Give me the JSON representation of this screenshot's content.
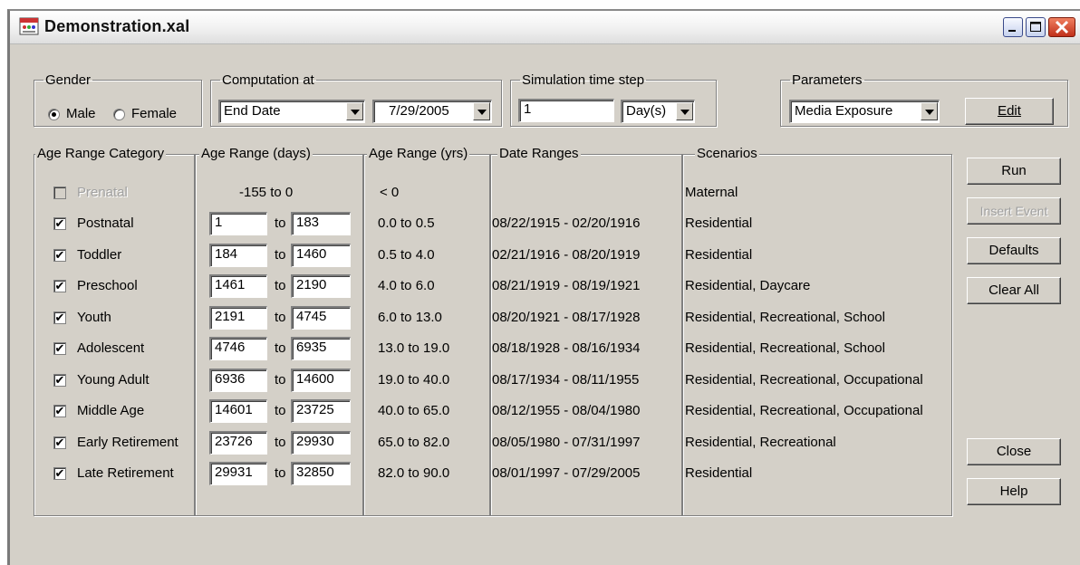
{
  "window": {
    "title": "Demonstration.xal"
  },
  "gender": {
    "legend": "Gender",
    "male_label": "Male",
    "female_label": "Female",
    "selected": "Male"
  },
  "computation": {
    "legend": "Computation at",
    "mode": "End Date",
    "date": "7/29/2005"
  },
  "timestep": {
    "legend": "Simulation time step",
    "value": "1",
    "unit": "Day(s)"
  },
  "parameters": {
    "legend": "Parameters",
    "selected": "Media Exposure",
    "edit_label": "Edit"
  },
  "columns": {
    "category": "Age Range Category",
    "days": "Age Range (days)",
    "years": "Age Range (yrs)",
    "dates": "Date Ranges",
    "scenarios": "Scenarios"
  },
  "to_label": "to",
  "prenatal": {
    "label": "Prenatal",
    "days": "-155 to 0",
    "years": "< 0",
    "scenarios": "Maternal"
  },
  "rows": [
    {
      "label": "Postnatal",
      "checked": true,
      "from": "1",
      "to": "183",
      "years": "0.0 to 0.5",
      "dates": "08/22/1915 - 02/20/1916",
      "scenarios": "Residential"
    },
    {
      "label": "Toddler",
      "checked": true,
      "from": "184",
      "to": "1460",
      "years": "0.5 to 4.0",
      "dates": "02/21/1916 - 08/20/1919",
      "scenarios": "Residential"
    },
    {
      "label": "Preschool",
      "checked": true,
      "from": "1461",
      "to": "2190",
      "years": "4.0 to 6.0",
      "dates": "08/21/1919 - 08/19/1921",
      "scenarios": "Residential, Daycare"
    },
    {
      "label": "Youth",
      "checked": true,
      "from": "2191",
      "to": "4745",
      "years": "6.0 to 13.0",
      "dates": "08/20/1921 - 08/17/1928",
      "scenarios": "Residential, Recreational, School"
    },
    {
      "label": "Adolescent",
      "checked": true,
      "from": "4746",
      "to": "6935",
      "years": "13.0 to 19.0",
      "dates": "08/18/1928 - 08/16/1934",
      "scenarios": "Residential, Recreational, School"
    },
    {
      "label": "Young Adult",
      "checked": true,
      "from": "6936",
      "to": "14600",
      "years": "19.0 to 40.0",
      "dates": "08/17/1934 - 08/11/1955",
      "scenarios": "Residential, Recreational, Occupational"
    },
    {
      "label": "Middle Age",
      "checked": true,
      "from": "14601",
      "to": "23725",
      "years": "40.0 to 65.0",
      "dates": "08/12/1955 - 08/04/1980",
      "scenarios": "Residential, Recreational, Occupational"
    },
    {
      "label": "Early Retirement",
      "checked": true,
      "from": "23726",
      "to": "29930",
      "years": "65.0 to 82.0",
      "dates": "08/05/1980 - 07/31/1997",
      "scenarios": "Residential, Recreational"
    },
    {
      "label": "Late Retirement",
      "checked": true,
      "from": "29931",
      "to": "32850",
      "years": "82.0 to 90.0",
      "dates": "08/01/1997 - 07/29/2005",
      "scenarios": "Residential"
    }
  ],
  "buttons": {
    "run": "Run",
    "insert_event": "Insert Event",
    "defaults": "Defaults",
    "clear_all": "Clear All",
    "close": "Close",
    "help": "Help"
  },
  "colors": {
    "dialog_bg": "#d4d0c8",
    "shadow": "#808080",
    "disabled_text": "#a0a0a0"
  }
}
